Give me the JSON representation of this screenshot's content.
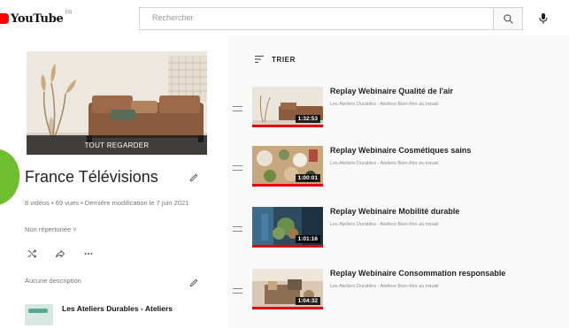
{
  "header": {
    "logo_text": "YouTube",
    "logo_region": "FR",
    "search_placeholder": "Rechercher",
    "search_icon": "search-icon",
    "mic_icon": "microphone-icon"
  },
  "playlist": {
    "play_all_label": "TOUT REGARDER",
    "title": "France Télévisions",
    "meta": "8 vidéos • 69 vues • Dernière modification le 7 juin 2021",
    "privacy": "Non répertoriée",
    "description": "Aucune description",
    "owner": "Les Ateliers Durables - Ateliers"
  },
  "list": {
    "sort_label": "TRIER",
    "items": [
      {
        "title": "Replay Webinaire Qualité de l'air",
        "channel": "Les Ateliers Durables - Ateliers Bien-être au travail",
        "duration": "1:32:53"
      },
      {
        "title": "Replay Webinaire Cosmétiques sains",
        "channel": "Les Ateliers Durables - Ateliers Bien-être au travail",
        "duration": "1:00:01"
      },
      {
        "title": "Replay Webinaire Mobilité durable",
        "channel": "Les Ateliers Durables - Ateliers Bien-être au travail",
        "duration": "1:01:16"
      },
      {
        "title": "Replay Webinaire Consommation responsable",
        "channel": "Les Ateliers Durables - Ateliers Bien-être au travail",
        "duration": "1:04:32"
      }
    ]
  },
  "colors": {
    "brand_red": "#ff0000",
    "progress_red": "#e60012",
    "accent_green": "#6dbf2e"
  }
}
